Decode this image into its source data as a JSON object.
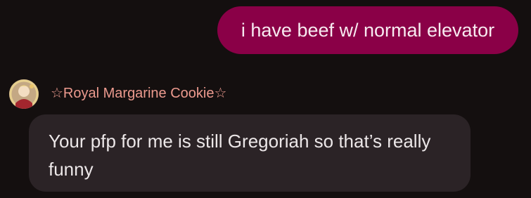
{
  "chat": {
    "outgoing": {
      "text": "i have beef w/ normal elevator"
    },
    "incoming": {
      "sender_name": "☆Royal Margarine Cookie☆",
      "text": "Your pfp for me is still Gregoriah so that’s really funny",
      "avatar": "avatar-image"
    }
  },
  "colors": {
    "background": "#140f0f",
    "outgoing_bubble": "#8a0047",
    "incoming_bubble": "#2b2326",
    "sender_name": "#ec9a8e"
  }
}
